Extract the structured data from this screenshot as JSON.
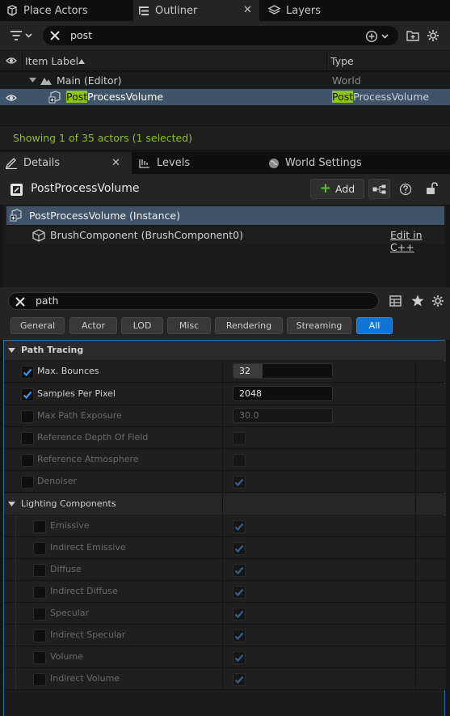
{
  "tabs": {
    "place_actors": "Place Actors",
    "outliner": "Outliner",
    "layers": "Layers"
  },
  "outliner": {
    "search_value": "post",
    "col_item_label": "Item Label",
    "col_type": "Type",
    "world_row": {
      "label": "Main (Editor)",
      "type": "World"
    },
    "actor_row": {
      "label_highlight": "Post",
      "label_rest": "ProcessVolume",
      "type_highlight": "Post",
      "type_rest": "ProcessVolume"
    },
    "status": "Showing 1 of 35 actors (1 selected)"
  },
  "details_tabs": {
    "details": "Details",
    "levels": "Levels",
    "world_settings": "World Settings"
  },
  "details": {
    "object_name": "PostProcessVolume",
    "add_label": "Add",
    "instance_row": "PostProcessVolume (Instance)",
    "brush_row": "BrushComponent (BrushComponent0)",
    "edit_link": "Edit in C++",
    "search_value": "path",
    "categories": [
      "General",
      "Actor",
      "LOD",
      "Misc",
      "Rendering",
      "Streaming",
      "All"
    ],
    "active_category": "All"
  },
  "path_tracing": {
    "title": "Path Tracing",
    "max_bounces": {
      "label": "Max. Bounces",
      "value": "32",
      "enabled": true
    },
    "samples_per_pixel": {
      "label": "Samples Per Pixel",
      "value": "2048",
      "enabled": true
    },
    "max_path_exposure": {
      "label": "Max Path Exposure",
      "value": "30.0",
      "enabled": false
    },
    "reference_dof": {
      "label": "Reference Depth Of Field",
      "enabled": false,
      "checked": false
    },
    "reference_atmosphere": {
      "label": "Reference Atmosphere",
      "enabled": false,
      "checked": false
    },
    "denoiser": {
      "label": "Denoiser",
      "enabled": false,
      "checked": true
    }
  },
  "lighting_components": {
    "title": "Lighting Components",
    "items": [
      {
        "label": "Emissive",
        "checked": true
      },
      {
        "label": "Indirect Emissive",
        "checked": true
      },
      {
        "label": "Diffuse",
        "checked": true
      },
      {
        "label": "Indirect Diffuse",
        "checked": true
      },
      {
        "label": "Specular",
        "checked": true
      },
      {
        "label": "Indirect Specular",
        "checked": true
      },
      {
        "label": "Volume",
        "checked": true
      },
      {
        "label": "Indirect Volume",
        "checked": true
      }
    ]
  },
  "colors": {
    "accent_blue": "#0f74d4",
    "search_highlight": "#8fc41b",
    "status_green": "#8bbf2b",
    "selection": "#3f5369"
  }
}
